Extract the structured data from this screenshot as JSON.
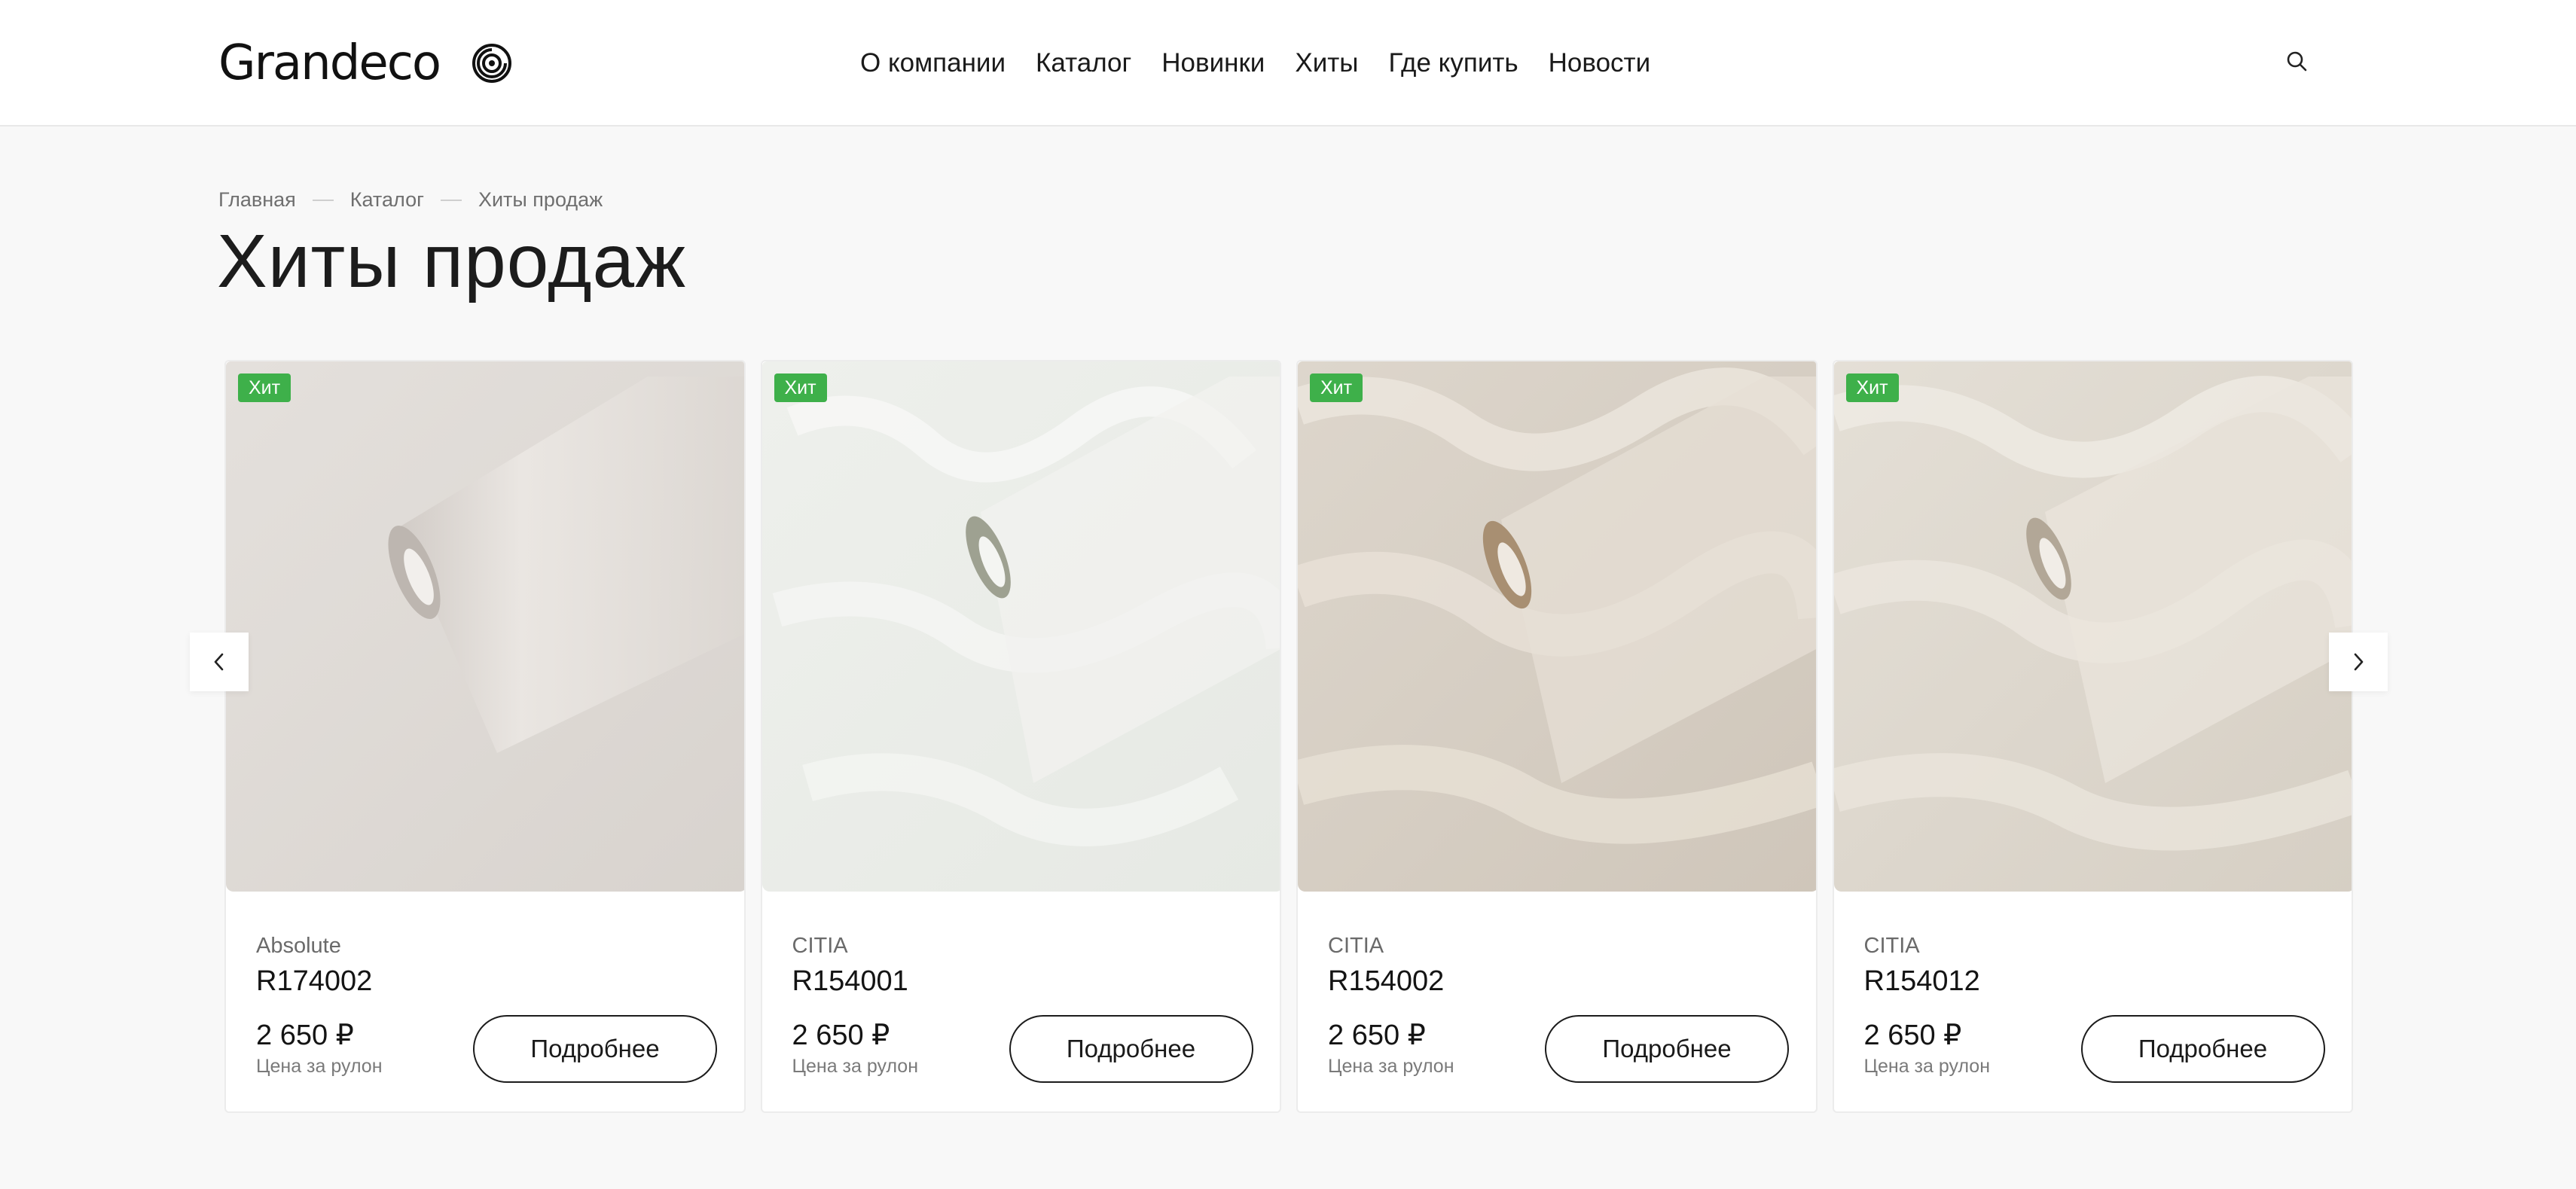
{
  "brand": {
    "name": "Grandeco",
    "logo_icon": "spiral-logo-icon"
  },
  "nav": {
    "items": [
      {
        "label": "О компании"
      },
      {
        "label": "Каталог"
      },
      {
        "label": "Новинки"
      },
      {
        "label": "Хиты"
      },
      {
        "label": "Где купить"
      },
      {
        "label": "Новости"
      }
    ],
    "search_icon": "search-icon"
  },
  "breadcrumb": [
    "Главная",
    "Каталог",
    "Хиты продаж"
  ],
  "page": {
    "title": "Хиты продаж"
  },
  "colors": {
    "badge": "#3eb04a",
    "text": "#1f1f1f",
    "background": "#f8f8f8"
  },
  "products": [
    {
      "badge": "Хит",
      "collection": "Absolute",
      "sku": "R174002",
      "price": "2 650 ₽",
      "price_note": "Цена за рулон",
      "button": "Подробнее",
      "image": "wallpaper-roll-plain-beige"
    },
    {
      "badge": "Хит",
      "collection": "CITIA",
      "sku": "R154001",
      "price": "2 650 ₽",
      "price_note": "Цена за рулон",
      "button": "Подробнее",
      "image": "wallpaper-roll-white-marble"
    },
    {
      "badge": "Хит",
      "collection": "CITIA",
      "sku": "R154002",
      "price": "2 650 ₽",
      "price_note": "Цена за рулон",
      "button": "Подробнее",
      "image": "wallpaper-roll-beige-marble"
    },
    {
      "badge": "Хит",
      "collection": "CITIA",
      "sku": "R154012",
      "price": "2 650 ₽",
      "price_note": "Цена за рулон",
      "button": "Подробнее",
      "image": "wallpaper-roll-cream-marble"
    }
  ],
  "carousel": {
    "prev_icon": "chevron-left-icon",
    "next_icon": "chevron-right-icon"
  }
}
